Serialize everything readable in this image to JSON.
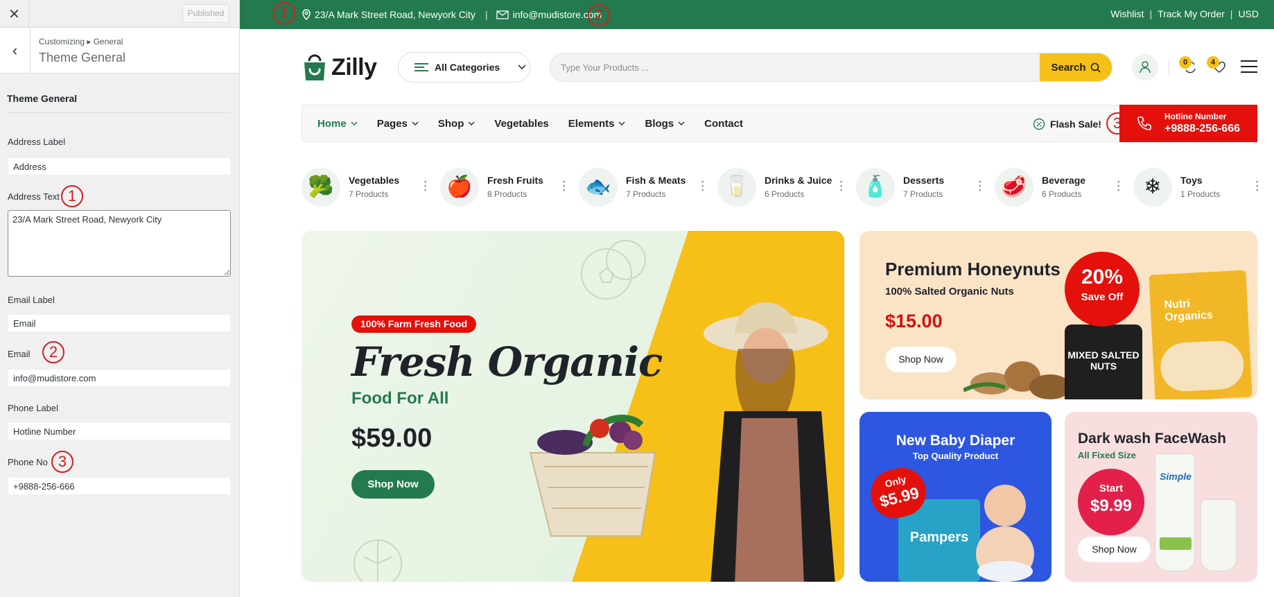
{
  "customizer": {
    "close": "✕",
    "published": "Published",
    "breadcrumb": "Customizing ▸ General",
    "title": "Theme General",
    "section": "Theme General",
    "address_label_label": "Address Label",
    "address_label_value": "Address",
    "address_text_label": "Address Text",
    "address_text_value": "23/A Mark Street Road, Newyork City",
    "email_label_label": "Email Label",
    "email_label_value": "Email",
    "email_label": "Email",
    "email_value": "info@mudistore.com",
    "phone_label_label": "Phone Label",
    "phone_label_value": "Hotline Number",
    "phone_no_label": "Phone No",
    "phone_no_value": "+9888-256-666",
    "marker_1": "1",
    "marker_2": "2",
    "marker_3": "3"
  },
  "site": {
    "topbar": {
      "address": "23/A Mark Street Road, Newyork City",
      "email": "info@mudistore.com",
      "separator": "|",
      "wishlist": "Wishlist",
      "track": "Track My Order",
      "currency": "USD",
      "dsep": "|"
    },
    "brand": "Zilly",
    "categories_button": "All Categories",
    "search": {
      "placeholder": "Type Your Products ...",
      "button": "Search"
    },
    "badges": {
      "compare": "0",
      "wishlist": "4"
    },
    "nav": {
      "items": [
        "Home",
        "Pages",
        "Shop",
        "Vegetables",
        "Elements",
        "Blogs",
        "Contact"
      ],
      "flash": "Flash Sale!",
      "hotline_label": "Hotline Number",
      "hotline_number": "+9888-256-666"
    },
    "categories": [
      {
        "name": "Vegetables",
        "count": "7 Products",
        "icon": "broccoli-icon",
        "glyph": "🥦"
      },
      {
        "name": "Fresh Fruits",
        "count": "8 Products",
        "icon": "fruit-bag-icon",
        "glyph": "🍎"
      },
      {
        "name": "Fish & Meats",
        "count": "7 Products",
        "icon": "fish-icon",
        "glyph": "🐟"
      },
      {
        "name": "Drinks & Juice",
        "count": "6 Products",
        "icon": "milk-icon",
        "glyph": "🥛"
      },
      {
        "name": "Desserts",
        "count": "7 Products",
        "icon": "dessert-icon",
        "glyph": "🧴"
      },
      {
        "name": "Beverage",
        "count": "6 Products",
        "icon": "steak-icon",
        "glyph": "🥩"
      },
      {
        "name": "Toys",
        "count": "1 Products",
        "icon": "snowflake-icon",
        "glyph": "❄"
      }
    ],
    "hero": {
      "tag": "100% Farm Fresh Food",
      "title": "Fresh Organic",
      "subtitle": "Food For All",
      "price": "$59.00",
      "button": "Shop Now"
    },
    "banner1": {
      "title": "Premium Honeynuts",
      "subtitle": "100% Salted Organic Nuts",
      "price": "$15.00",
      "button": "Shop Now",
      "off_pct": "20%",
      "off_text": "Save Off",
      "jar_label": "MIXED SALTED NUTS",
      "pack_label": "Nutri Organics"
    },
    "banner2": {
      "title": "New Baby Diaper",
      "subtitle": "Top Quality Product",
      "only": "Only",
      "price": "$5.99",
      "pack_label": "Pampers"
    },
    "banner3": {
      "title": "Dark wash FaceWash",
      "subtitle": "All Fixed Size",
      "start": "Start",
      "price": "$9.99",
      "button": "Shop Now",
      "brand": "Simple"
    },
    "colors": {
      "green": "#237a4f",
      "yellow": "#f7c018",
      "red": "#e3100c"
    }
  }
}
